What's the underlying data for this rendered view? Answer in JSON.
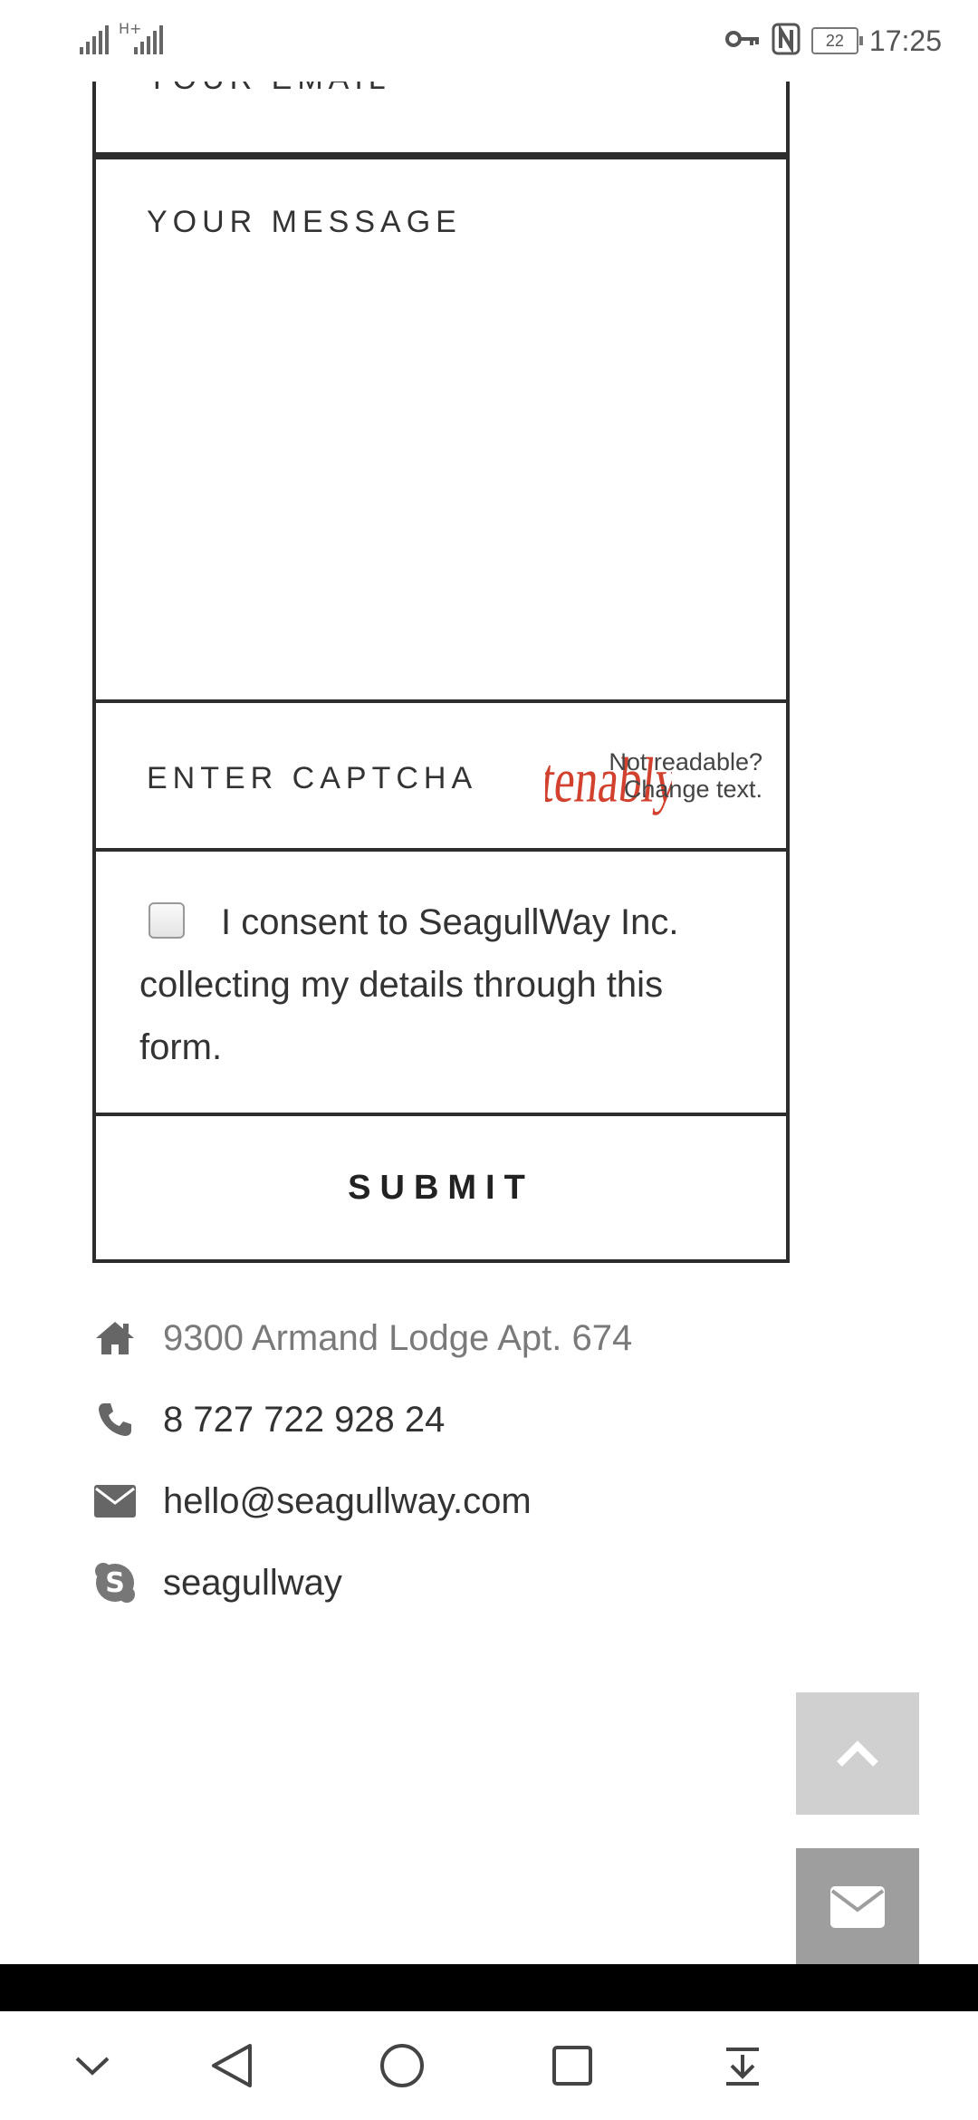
{
  "status_bar": {
    "network": "H+",
    "battery": "22",
    "time": "17:25"
  },
  "form": {
    "email_placeholder": "YOUR EMAIL",
    "message_placeholder": "YOUR MESSAGE",
    "captcha_placeholder": "ENTER CAPTCHA",
    "captcha_text": "tenably",
    "captcha_change_line1": "Not readable?",
    "captcha_change_line2": "Change text.",
    "consent_text": "I consent to SeagullWay Inc. collecting my details through this form.",
    "submit_label": "SUBMIT"
  },
  "contact": {
    "address": "9300 Armand Lodge Apt. 674",
    "phone": "8 727 722 928 24",
    "email": "hello@seagullway.com",
    "skype": "seagullway"
  },
  "icons": {
    "address": "home-icon",
    "phone": "phone-icon",
    "email": "envelope-icon",
    "skype": "skype-icon",
    "scroll_top": "chevron-up-icon",
    "mail_fab": "envelope-icon"
  },
  "colors": {
    "border": "#2d2d2d",
    "captcha_red": "#d2402e",
    "fab_top": "#d0d0d0",
    "fab_mail": "#9e9e9e"
  }
}
